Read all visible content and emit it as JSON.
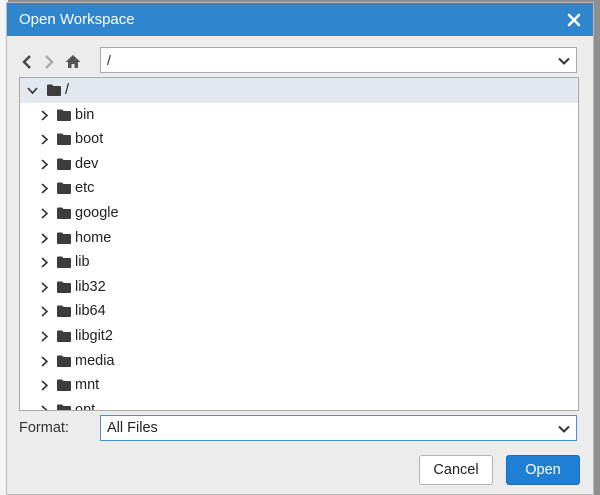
{
  "dialog": {
    "title": "Open Workspace",
    "close_icon": "close-icon"
  },
  "nav": {
    "back_icon": "chevron-left-icon",
    "forward_icon": "chevron-right-icon",
    "home_icon": "home-icon"
  },
  "path": {
    "value": "/"
  },
  "tree": {
    "root": {
      "label": "/",
      "expanded": true
    },
    "items": [
      {
        "label": "bin"
      },
      {
        "label": "boot"
      },
      {
        "label": "dev"
      },
      {
        "label": "etc"
      },
      {
        "label": "google"
      },
      {
        "label": "home"
      },
      {
        "label": "lib"
      },
      {
        "label": "lib32"
      },
      {
        "label": "lib64"
      },
      {
        "label": "libgit2"
      },
      {
        "label": "media"
      },
      {
        "label": "mnt"
      },
      {
        "label": "opt"
      }
    ]
  },
  "format": {
    "label": "Format:",
    "value": "All Files"
  },
  "buttons": {
    "cancel": "Cancel",
    "open": "Open"
  },
  "colors": {
    "titlebar": "#2f86ce",
    "primary_button": "#1f7fd4",
    "selected_row": "#e3e7f0"
  }
}
